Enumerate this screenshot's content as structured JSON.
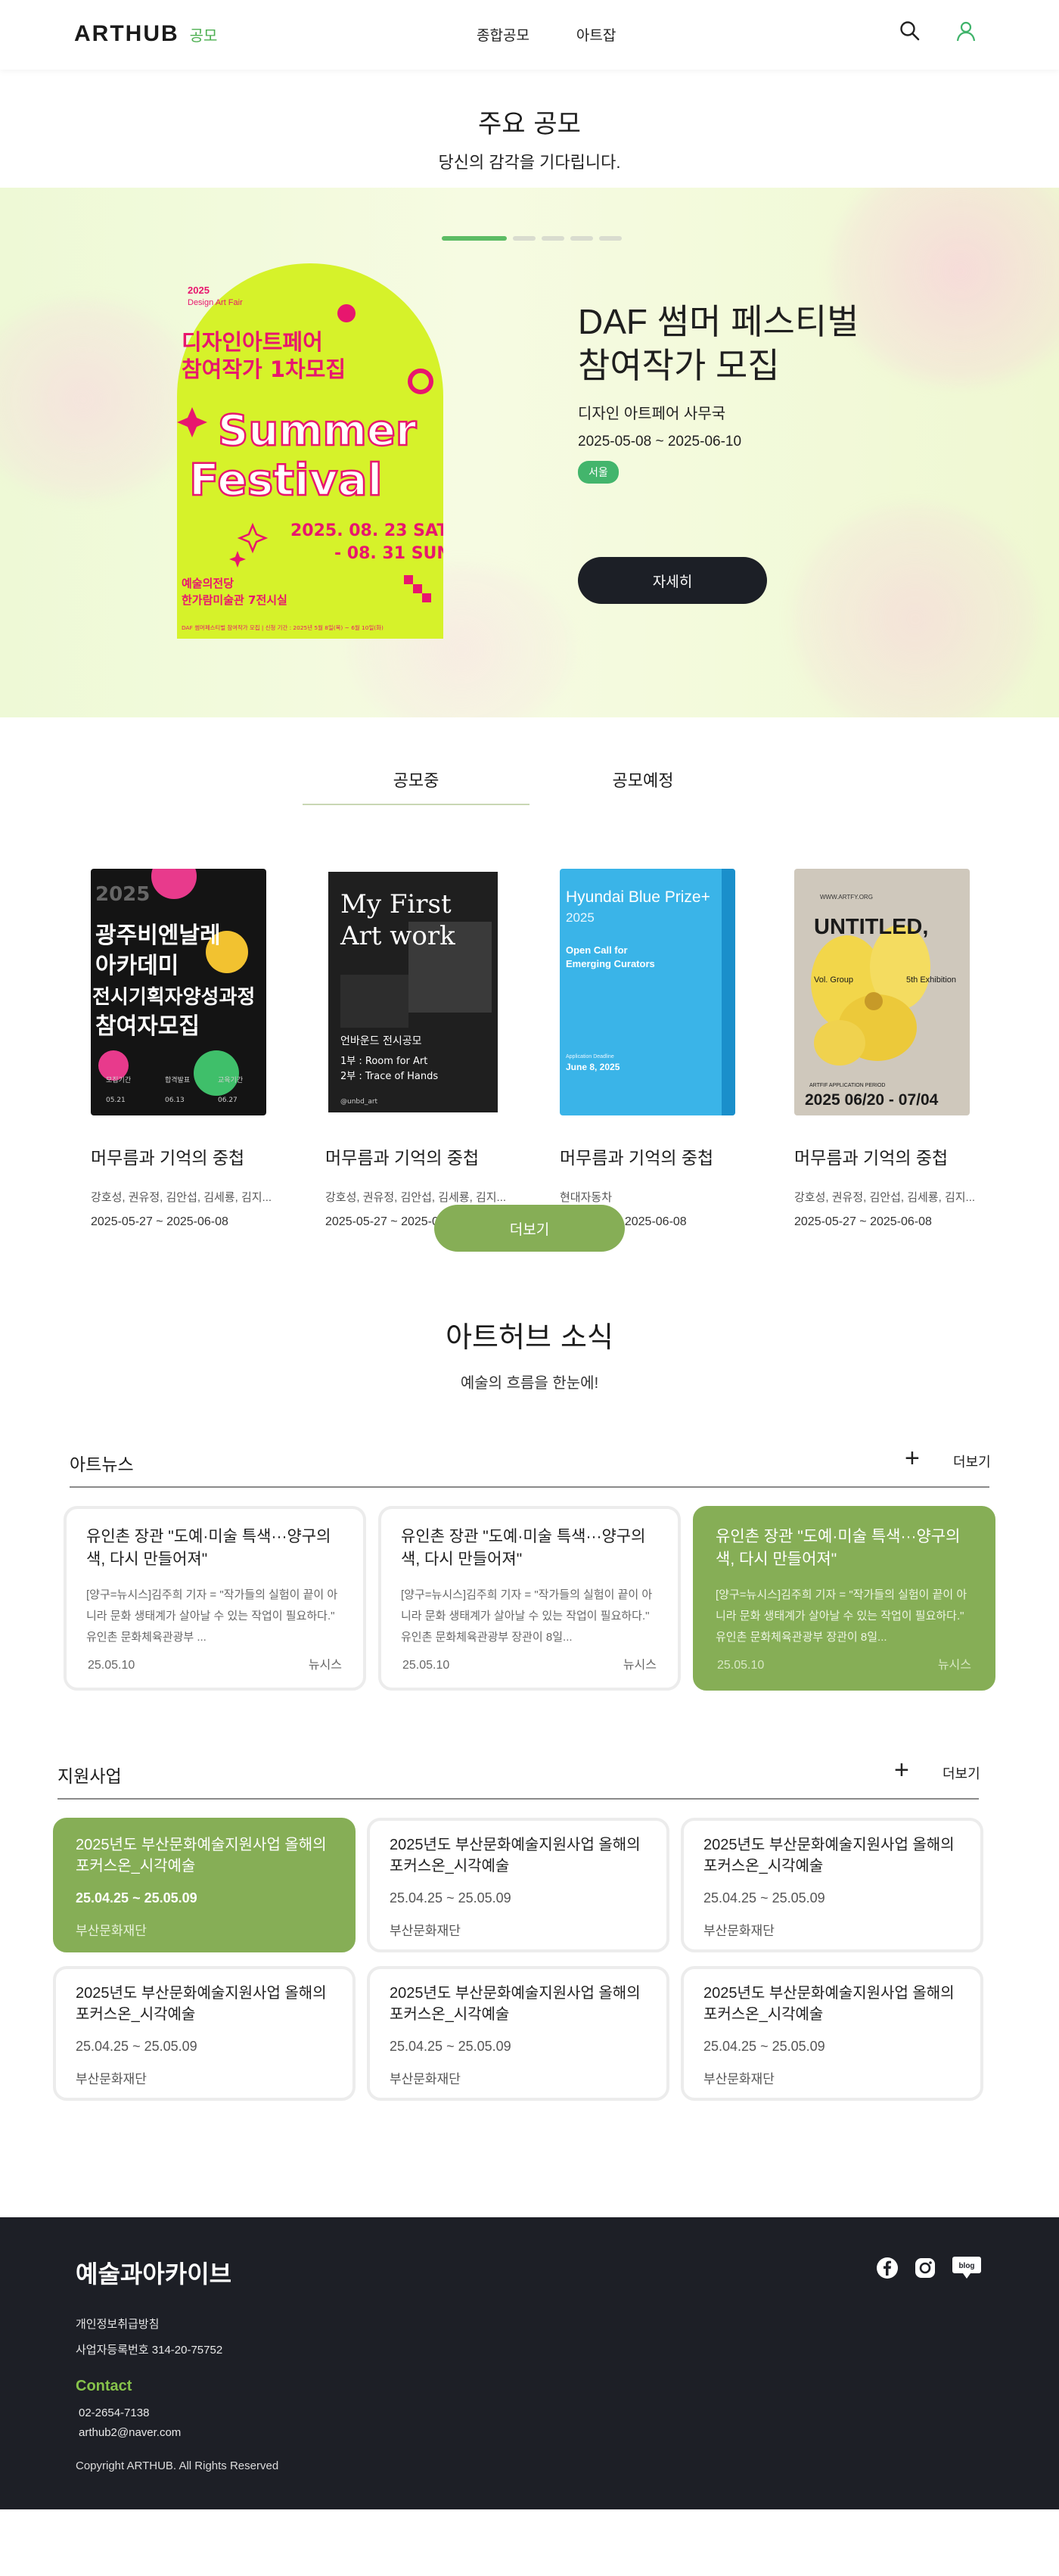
{
  "header": {
    "logo": "ARTHUB",
    "logo_sub": "공모",
    "nav": [
      "종합공모",
      "아트잡"
    ]
  },
  "featured": {
    "title": "주요 공모",
    "subtitle": "당신의 감각을 기다립니다.",
    "slide_count": 5,
    "active_slide": 1,
    "poster": {
      "top_year": "2025",
      "top_small": "Design Art Fair",
      "heading_line1": "디자인아트페어",
      "heading_line2": "참여작가 1차모집",
      "word1": "Summer",
      "word2": "Festival",
      "dates_line1": "2025. 08. 23 SAT",
      "dates_line2": "- 08. 31 SUN",
      "venue_line1": "예술의전당",
      "venue_line2": "한가람미술관 7전시실",
      "bottom": "DAF 썸머페스티벌 참여작가 모집 | 신청 기간 : 2025년 5월 8일(목) ~ 6월 10일(화)"
    },
    "title_line1": "DAF 썸머 페스티벌",
    "title_line2": "참여작가 모집",
    "organizer": "디자인 아트페어 사무국",
    "period": "2025-05-08 ~ 2025-06-10",
    "region_tag": "서울",
    "detail_button": "자세히"
  },
  "tabs": [
    "공모중",
    "공모예정"
  ],
  "contests": [
    {
      "title": "머무름과 기억의 중첩",
      "names": "강호성, 권유정, 김안섭, 김세룡, 김지...",
      "period": "2025-05-27 ~ 2025-06-08",
      "poster": {
        "year": "2025",
        "lines": [
          "광주비엔날레",
          "아카데미",
          "전시기획자양성과정",
          "참여자모집"
        ],
        "info1": "모집기간",
        "info2": "합격발표",
        "info3": "교육기간",
        "d1": "05.21",
        "d2": "06.13",
        "d3": "06.27"
      }
    },
    {
      "title": "머무름과 기억의 중첩",
      "names": "강호성, 권유정, 김안섭, 김세룡, 김지...",
      "period": "2025-05-27 ~ 2025-06-08",
      "poster": {
        "line1": "My First",
        "line2": "Art work",
        "caption": "언바운드 전시공모",
        "part1": "1부 : Room for Art",
        "part2": "2부 : Trace of Hands",
        "handle": "@unbd_art"
      }
    },
    {
      "title": "머무름과 기억의 중첩",
      "names": "현대자동차",
      "period": "2025-050 ~ 2025-06-08",
      "poster": {
        "line1": "Hyundai Blue Prize+",
        "line2": "2025",
        "line3": "Open Call for",
        "line4": "Emerging Curators",
        "small": "Application Deadline",
        "deadline": "June 8, 2025"
      }
    },
    {
      "title": "머무름과 기억의 중첩",
      "names": "강호성, 권유정, 김안섭, 김세룡, 김지...",
      "period": "2025-05-27 ~ 2025-06-08",
      "poster": {
        "tag": "WWW.ARTFY.ORG",
        "headline": "UNTITLED,",
        "vol": "Vol. Group",
        "fifth": "5th Exhibition",
        "period_label": "ARTFIF APPLICATION PERIOD",
        "dates": "2025 06/20 - 07/04"
      }
    }
  ],
  "more_button": "더보기",
  "news_section": {
    "title": "아트허브 소식",
    "subtitle": "예술의 흐름을 한눈에!"
  },
  "art_news": {
    "heading": "아트뉴스",
    "more": "더보기",
    "items": [
      {
        "title": "유인촌 장관 \"도예·미술 특색···양구의 색, 다시 만들어져\"",
        "body": "[양구=뉴시스]김주희 기자 = \"작가들의 실험이 끝이 아니라 문화 생태계가 살아날 수 있는 작업이 필요하다.\" 유인촌 문화체육관광부 ...",
        "date": "25.05.10",
        "source": "뉴시스"
      },
      {
        "title": "유인촌 장관 \"도예·미술 특색···양구의 색, 다시 만들어져\"",
        "body": "[양구=뉴시스]김주희 기자 = \"작가들의 실험이 끝이 아니라 문화 생태계가 살아날 수 있는 작업이 필요하다.\" 유인촌 문화체육관광부 장관이 8일...",
        "date": "25.05.10",
        "source": "뉴시스"
      },
      {
        "title": "유인촌 장관 \"도예·미술 특색···양구의 색, 다시 만들어져\"",
        "body": "[양구=뉴시스]김주희 기자 = \"작가들의 실험이 끝이 아니라 문화 생태계가 살아날 수 있는 작업이 필요하다.\" 유인촌 문화체육관광부 장관이 8일...",
        "date": "25.05.10",
        "source": "뉴시스"
      }
    ]
  },
  "support": {
    "heading": "지원사업",
    "more": "더보기",
    "items": [
      {
        "title": "2025년도 부산문화예술지원사업 올해의 포커스온_시각예술",
        "period": "25.04.25 ~ 25.05.09",
        "org": "부산문화재단"
      },
      {
        "title": "2025년도 부산문화예술지원사업 올해의 포커스온_시각예술",
        "period": "25.04.25 ~ 25.05.09",
        "org": "부산문화재단"
      },
      {
        "title": "2025년도 부산문화예술지원사업 올해의 포커스온_시각예술",
        "period": "25.04.25 ~ 25.05.09",
        "org": "부산문화재단"
      },
      {
        "title": "2025년도 부산문화예술지원사업 올해의 포커스온_시각예술",
        "period": "25.04.25 ~ 25.05.09",
        "org": "부산문화재단"
      },
      {
        "title": "2025년도 부산문화예술지원사업 올해의 포커스온_시각예술",
        "period": "25.04.25 ~ 25.05.09",
        "org": "부산문화재단"
      },
      {
        "title": "2025년도 부산문화예술지원사업 올해의 포커스온_시각예술",
        "period": "25.04.25 ~ 25.05.09",
        "org": "부산문화재단"
      }
    ]
  },
  "footer": {
    "brand": "예술과아카이브",
    "privacy": "개인정보취급방침",
    "biz_no": "사업자등록번호 314-20-75752",
    "contact_label": "Contact",
    "phone": "02-2654-7138",
    "email": "arthub2@naver.com",
    "copyright": "Copyright ARTHUB. All Rights Reserved",
    "blog_label": "blog"
  },
  "colors": {
    "accent_green": "#86ae56",
    "indicator_green": "#5cbc64",
    "tag_green": "#43b56c",
    "dark": "#1d1f26"
  }
}
